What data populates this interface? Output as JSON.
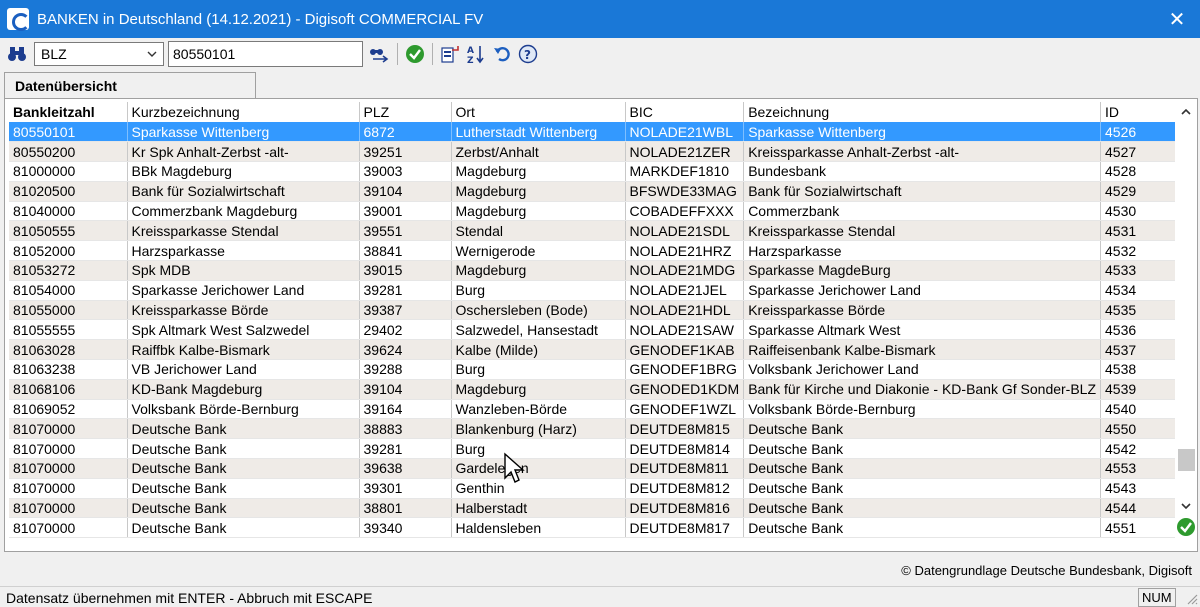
{
  "window": {
    "title": "BANKEN in Deutschland (14.12.2021) - Digisoft COMMERCIAL FV",
    "close_glyph": "✕"
  },
  "toolbar": {
    "field_selected": "BLZ",
    "search_value": "80550101",
    "icons": [
      "binoculars-icon",
      "find-next-icon",
      "ok-icon",
      "export-icon",
      "sort-icon",
      "undo-icon",
      "help-icon"
    ]
  },
  "tabs": [
    {
      "label": "Datenübersicht"
    }
  ],
  "table": {
    "columns": [
      "Bankleitzahl",
      "Kurzbezeichnung",
      "PLZ",
      "Ort",
      "BIC",
      "Bezeichnung",
      "ID"
    ],
    "rows": [
      [
        "80550101",
        "Sparkasse Wittenberg",
        "6872",
        "Lutherstadt Wittenberg",
        "NOLADE21WBL",
        "Sparkasse Wittenberg",
        "4526"
      ],
      [
        "80550200",
        "Kr Spk Anhalt-Zerbst -alt-",
        "39251",
        "Zerbst/Anhalt",
        "NOLADE21ZER",
        "Kreissparkasse Anhalt-Zerbst -alt-",
        "4527"
      ],
      [
        "81000000",
        "BBk Magdeburg",
        "39003",
        "Magdeburg",
        "MARKDEF1810",
        "Bundesbank",
        "4528"
      ],
      [
        "81020500",
        "Bank für Sozialwirtschaft",
        "39104",
        "Magdeburg",
        "BFSWDE33MAG",
        "Bank für Sozialwirtschaft",
        "4529"
      ],
      [
        "81040000",
        "Commerzbank Magdeburg",
        "39001",
        "Magdeburg",
        "COBADEFFXXX",
        "Commerzbank",
        "4530"
      ],
      [
        "81050555",
        "Kreissparkasse Stendal",
        "39551",
        "Stendal",
        "NOLADE21SDL",
        "Kreissparkasse Stendal",
        "4531"
      ],
      [
        "81052000",
        "Harzsparkasse",
        "38841",
        "Wernigerode",
        "NOLADE21HRZ",
        "Harzsparkasse",
        "4532"
      ],
      [
        "81053272",
        "Spk MDB",
        "39015",
        "Magdeburg",
        "NOLADE21MDG",
        "Sparkasse MagdeBurg",
        "4533"
      ],
      [
        "81054000",
        "Sparkasse Jerichower Land",
        "39281",
        "Burg",
        "NOLADE21JEL",
        "Sparkasse Jerichower Land",
        "4534"
      ],
      [
        "81055000",
        "Kreissparkasse Börde",
        "39387",
        "Oschersleben (Bode)",
        "NOLADE21HDL",
        "Kreissparkasse Börde",
        "4535"
      ],
      [
        "81055555",
        "Spk Altmark West Salzwedel",
        "29402",
        "Salzwedel, Hansestadt",
        "NOLADE21SAW",
        "Sparkasse Altmark West",
        "4536"
      ],
      [
        "81063028",
        "Raiffbk Kalbe-Bismark",
        "39624",
        "Kalbe (Milde)",
        "GENODEF1KAB",
        "Raiffeisenbank Kalbe-Bismark",
        "4537"
      ],
      [
        "81063238",
        "VB Jerichower Land",
        "39288",
        "Burg",
        "GENODEF1BRG",
        "Volksbank Jerichower Land",
        "4538"
      ],
      [
        "81068106",
        "KD-Bank Magdeburg",
        "39104",
        "Magdeburg",
        "GENODED1KDM",
        "Bank für Kirche und Diakonie - KD-Bank Gf Sonder-BLZ",
        "4539"
      ],
      [
        "81069052",
        "Volksbank Börde-Bernburg",
        "39164",
        "Wanzleben-Börde",
        "GENODEF1WZL",
        "Volksbank Börde-Bernburg",
        "4540"
      ],
      [
        "81070000",
        "Deutsche Bank",
        "38883",
        "Blankenburg (Harz)",
        "DEUTDE8M815",
        "Deutsche Bank",
        "4550"
      ],
      [
        "81070000",
        "Deutsche Bank",
        "39281",
        "Burg",
        "DEUTDE8M814",
        "Deutsche Bank",
        "4542"
      ],
      [
        "81070000",
        "Deutsche Bank",
        "39638",
        "Gardelegen",
        "DEUTDE8M811",
        "Deutsche Bank",
        "4553"
      ],
      [
        "81070000",
        "Deutsche Bank",
        "39301",
        "Genthin",
        "DEUTDE8M812",
        "Deutsche Bank",
        "4543"
      ],
      [
        "81070000",
        "Deutsche Bank",
        "38801",
        "Halberstadt",
        "DEUTDE8M816",
        "Deutsche Bank",
        "4544"
      ],
      [
        "81070000",
        "Deutsche Bank",
        "39340",
        "Haldensleben",
        "DEUTDE8M817",
        "Deutsche Bank",
        "4551"
      ]
    ],
    "selected_row": 0
  },
  "footer": {
    "credit": "© Datengrundlage Deutsche Bundesbank, Digisoft",
    "status": "Datensatz übernehmen mit ENTER - Abbruch mit ESCAPE",
    "num_indicator": "NUM"
  },
  "colors": {
    "titlebar": "#1a78d7",
    "selection": "#3399ff",
    "alt_row": "#efebe7"
  }
}
